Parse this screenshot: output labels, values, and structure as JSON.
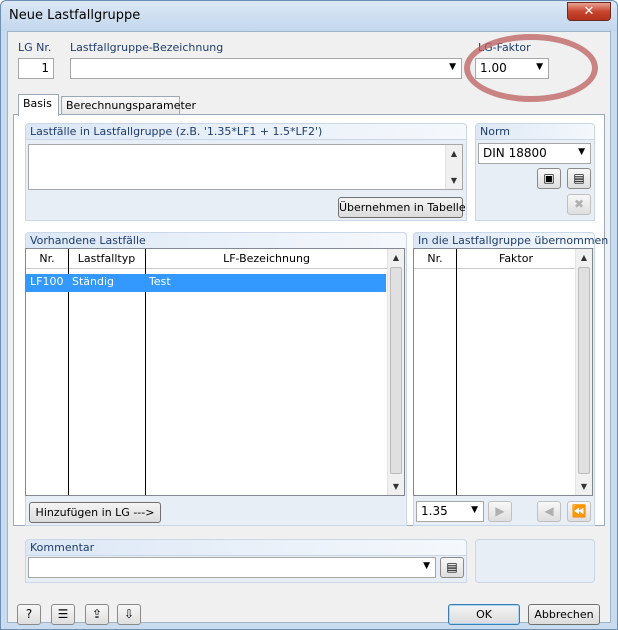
{
  "window": {
    "title": "Neue Lastfallgruppe",
    "close_icon": "✕"
  },
  "header": {
    "lg_nr_label": "LG Nr.",
    "lg_nr_value": "1",
    "bezeichnung_label": "Lastfallgruppe-Bezeichnung",
    "bezeichnung_value": "",
    "faktor_label": "LG-Faktor",
    "faktor_value": "1.00"
  },
  "tabs": [
    {
      "label": "Basis",
      "active": true
    },
    {
      "label": "Berechnungsparameter",
      "active": false
    }
  ],
  "lastfaelle_group": {
    "title": "Lastfälle in Lastfallgruppe (z.B. '1.35*LF1 + 1.5*LF2')",
    "apply_button": "Übernehmen in Tabelle"
  },
  "norm_group": {
    "title": "Norm",
    "selected": "DIN 18800"
  },
  "vorhandene": {
    "title": "Vorhandene Lastfälle",
    "columns": [
      "Nr.",
      "Lastfalltyp",
      "LF-Bezeichnung"
    ],
    "rows": [
      {
        "nr": "LF100",
        "typ": "Ständig",
        "bez": "Test"
      }
    ],
    "add_button": "Hinzufügen in LG --->"
  },
  "uebernommen": {
    "title": "In die Lastfallgruppe übernommen",
    "columns": [
      "Nr.",
      "Faktor"
    ],
    "factor_value": "1.35"
  },
  "kommentar": {
    "title": "Kommentar",
    "value": ""
  },
  "footer": {
    "ok": "OK",
    "cancel": "Abbrechen"
  }
}
